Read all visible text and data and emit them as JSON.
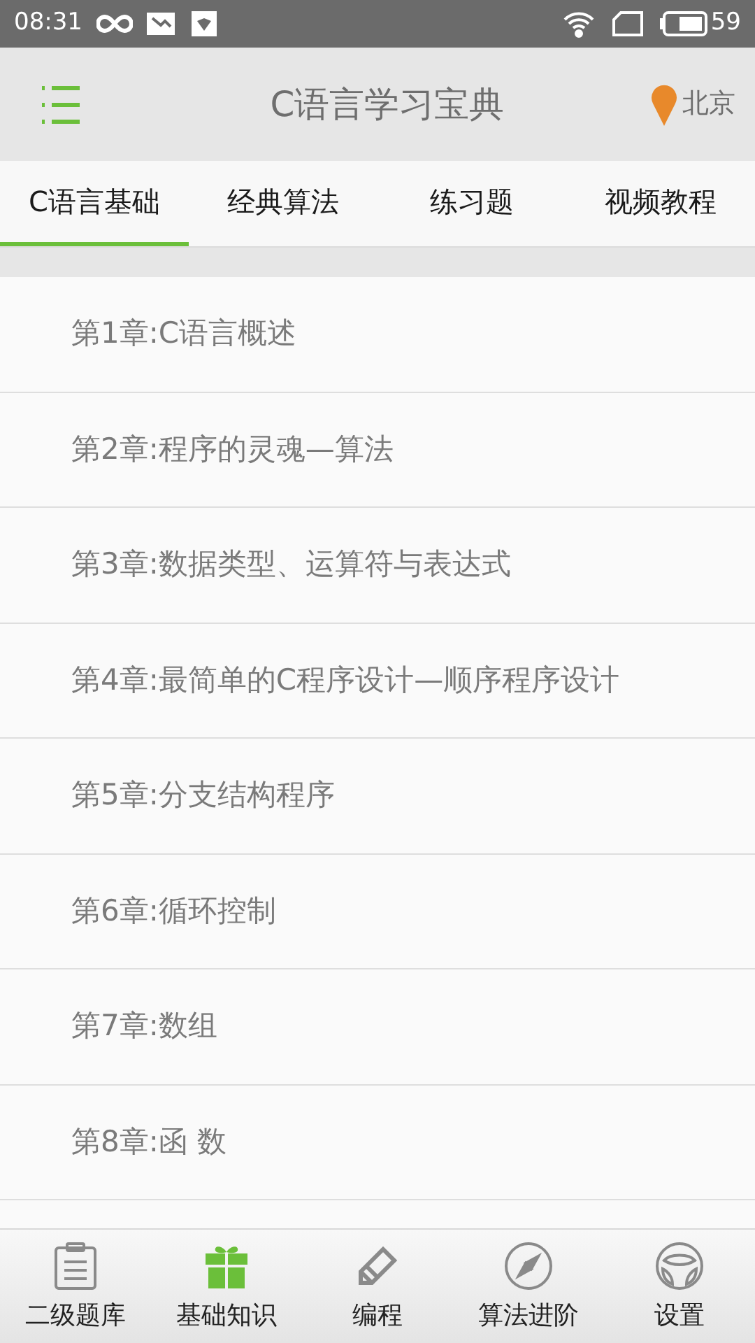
{
  "status_bar": {
    "time": "08:31",
    "battery": "59"
  },
  "header": {
    "title": "C语言学习宝典",
    "location": "北京"
  },
  "tabs": [
    {
      "label": "C语言基础",
      "selected": true
    },
    {
      "label": "经典算法",
      "selected": false
    },
    {
      "label": "练习题",
      "selected": false
    },
    {
      "label": "视频教程",
      "selected": false
    }
  ],
  "chapters": [
    "第1章:C语言概述",
    "第2章:程序的灵魂—算法",
    "第3章:数据类型、运算符与表达式",
    "第4章:最简单的C程序设计—顺序程序设计",
    "第5章:分支结构程序",
    "第6章:循环控制",
    "第7章:数组",
    "第8章:函 数"
  ],
  "bottom_nav": [
    {
      "kind": "clipboard",
      "label": "二级题库",
      "selected": false
    },
    {
      "kind": "gift",
      "label": "基础知识",
      "selected": true
    },
    {
      "kind": "pencil",
      "label": "编程",
      "selected": false
    },
    {
      "kind": "compass",
      "label": "算法进阶",
      "selected": false
    },
    {
      "kind": "wheel",
      "label": "设置",
      "selected": false
    }
  ]
}
